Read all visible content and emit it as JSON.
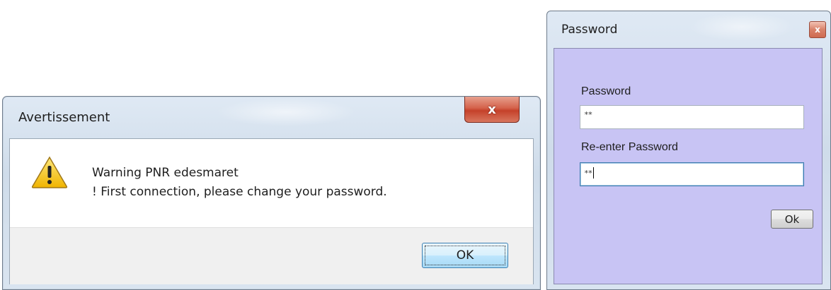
{
  "warning_dialog": {
    "title": "Avertissement",
    "close_label": "x",
    "icon": "warning-triangle-icon",
    "message_line1": "Warning PNR edesmaret",
    "message_line2": "! First connection, please change your password.",
    "ok_label": "OK"
  },
  "password_dialog": {
    "title": "Password",
    "close_label": "x",
    "background_color": "#c8c4f4",
    "password_label": "Password",
    "password_value": "**",
    "reenter_label": "Re-enter Password",
    "reenter_value": "**",
    "ok_label": "Ok"
  }
}
